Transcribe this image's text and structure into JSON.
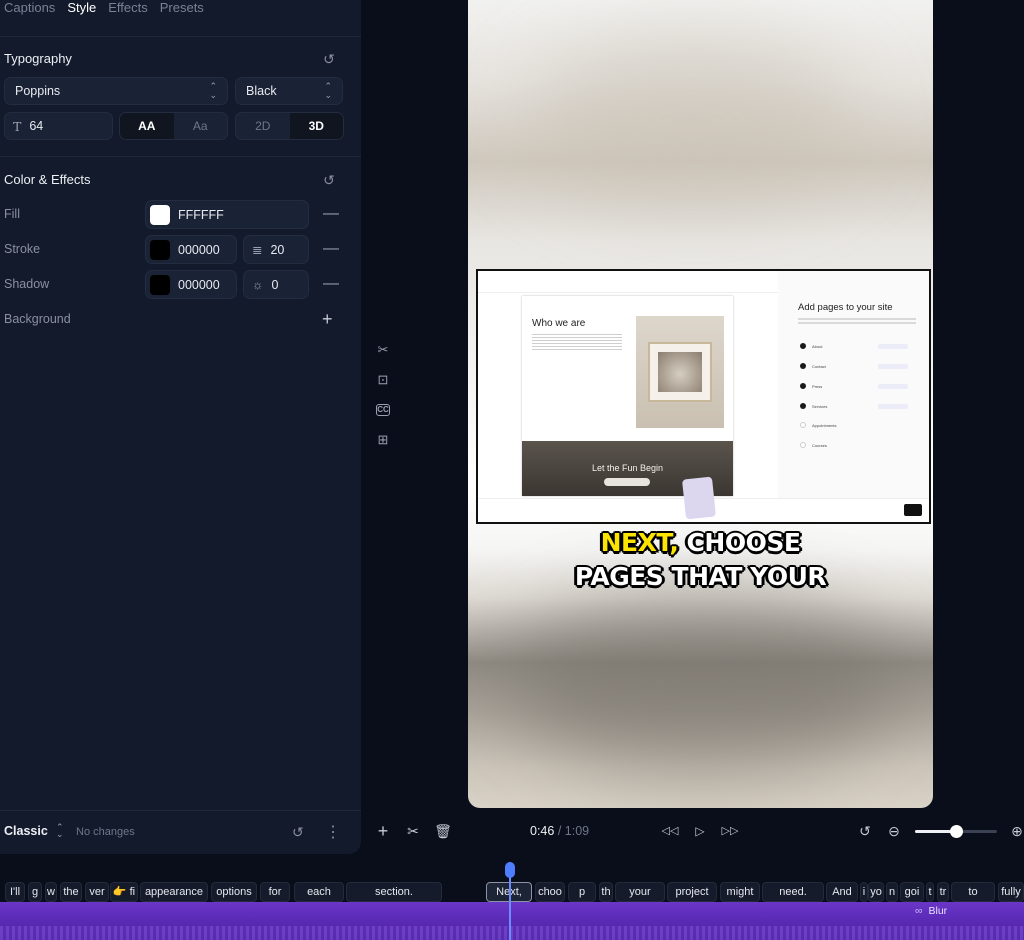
{
  "tabs": [
    "Captions",
    "Style",
    "Effects",
    "Presets"
  ],
  "typography": {
    "title": "Typography",
    "font": "Poppins",
    "weight": "Black",
    "size_icon": "T",
    "size": "64",
    "case_options": [
      "AA",
      "Aa"
    ],
    "case_selected": "AA",
    "dim_options": [
      "2D",
      "3D"
    ],
    "dim_selected": "3D"
  },
  "color_effects": {
    "title": "Color & Effects",
    "fill": {
      "label": "Fill",
      "hex": "FFFFFF",
      "color": "#FFFFFF"
    },
    "stroke": {
      "label": "Stroke",
      "hex": "000000",
      "color": "#000000",
      "width": "20"
    },
    "shadow": {
      "label": "Shadow",
      "hex": "000000",
      "color": "#000000",
      "blur": "0"
    },
    "background": {
      "label": "Background"
    }
  },
  "footer": {
    "preset": "Classic",
    "status": "No changes"
  },
  "preview": {
    "caption_highlight": "NEXT,",
    "caption_line1_rest": " CHOOSE",
    "caption_line2": "PAGES THAT YOUR",
    "highlight_color": "#FBE500",
    "embedded": {
      "site_heading": "Who we are",
      "banner_text": "Let the Fun Begin",
      "panel_title": "Add pages to your site",
      "options": [
        {
          "label": "About",
          "checked": true
        },
        {
          "label": "Contact",
          "checked": true
        },
        {
          "label": "Press",
          "checked": true
        },
        {
          "label": "Services",
          "checked": true
        },
        {
          "label": "Appointments",
          "checked": false
        },
        {
          "label": "Courses",
          "checked": false
        }
      ]
    }
  },
  "playback": {
    "current": "0:46",
    "total": "1:09",
    "zoom_level": 0.5
  },
  "timeline": {
    "words": [
      "I'll",
      "g",
      "w",
      "the",
      "ver",
      "👉 fi",
      "appearance",
      "options",
      "for",
      "each",
      "section.",
      "Next,",
      "choo",
      "p",
      "th",
      "your",
      "project",
      "might",
      "need.",
      "And",
      "i",
      "yo",
      "n",
      "goi",
      "t",
      "tr",
      "to",
      "fully"
    ],
    "current_word": "Next,",
    "effect_label": "Blur",
    "track_color": "#6A36C8"
  }
}
